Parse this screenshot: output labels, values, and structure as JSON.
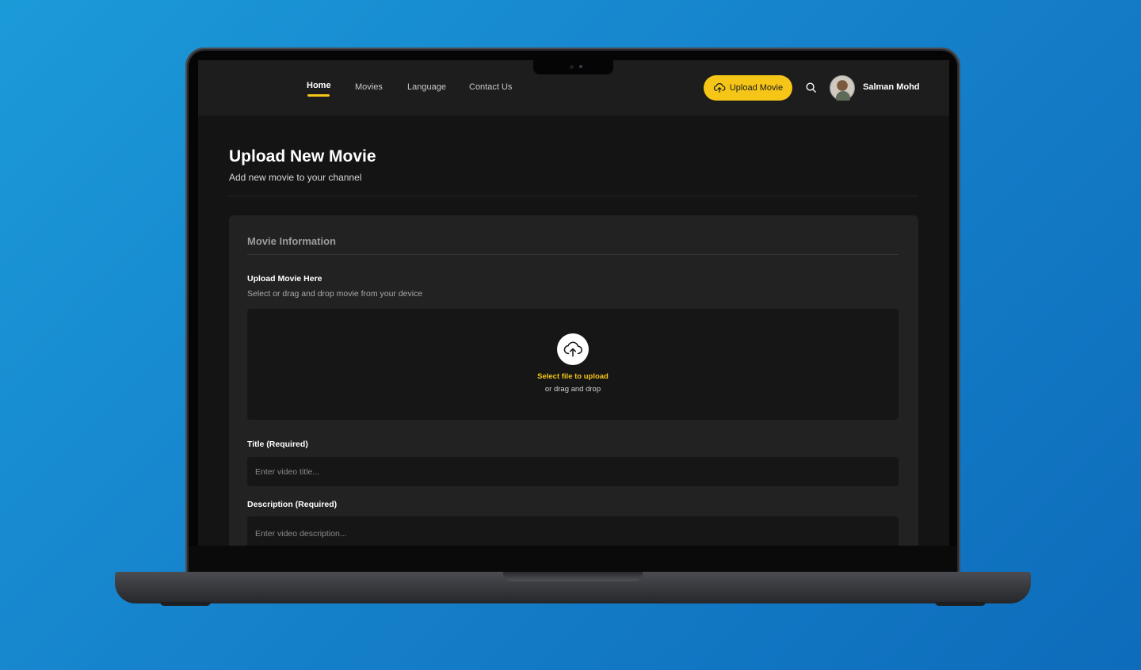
{
  "nav": {
    "links": [
      "Home",
      "Movies",
      "Language",
      "Contact Us"
    ],
    "active": "Home",
    "upload_button": "Upload Movie",
    "user_name": "Salman Mohd"
  },
  "page": {
    "title": "Upload New Movie",
    "subtitle": "Add new movie to your channel"
  },
  "card": {
    "title": "Movie Information",
    "upload": {
      "label": "Upload Movie Here",
      "hint": "Select or drag and drop movie from your device",
      "primary": "Select file to upload",
      "secondary": "or drag and drop"
    },
    "title_field": {
      "label": "Title (Required)",
      "placeholder": "Enter video title..."
    },
    "description_field": {
      "label": "Description (Required)",
      "placeholder": "Enter video description..."
    }
  },
  "colors": {
    "background": "#1683cc",
    "accent": "#f5c518",
    "screen": "#141414",
    "card": "#222222"
  },
  "icons": [
    "cloud-upload-icon",
    "search-icon"
  ]
}
